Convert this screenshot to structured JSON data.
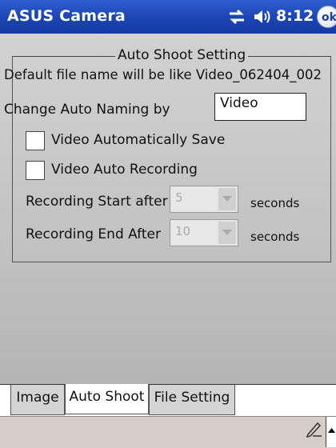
{
  "titlebar": {
    "title": "ASUS Camera",
    "clock": "8:12",
    "ok_label": "ok"
  },
  "group": {
    "title": "Auto Shoot Setting",
    "default_name_text": "Default file name will be like Video_062404_002",
    "naming_label": "Change Auto Naming by",
    "naming_value": "Video",
    "auto_save_label": "Video Automatically Save",
    "auto_record_label": "Video Auto Recording",
    "start_label": "Recording Start after",
    "start_value": "5",
    "start_unit": "seconds",
    "end_label": "Recording End After",
    "end_value": "10",
    "end_unit": "seconds"
  },
  "tabs": [
    {
      "label": "Image"
    },
    {
      "label": "Auto Shoot"
    },
    {
      "label": "File Setting"
    }
  ],
  "icons": {
    "signal": "connectivity-icon",
    "volume": "speaker-icon",
    "pencil": "pencil-icon",
    "sip": "sip-arrow-icon"
  },
  "colors": {
    "titlebar": "#1c44b3",
    "content_bg": "#c6c6c6",
    "menubar": "#d6cdc8"
  }
}
